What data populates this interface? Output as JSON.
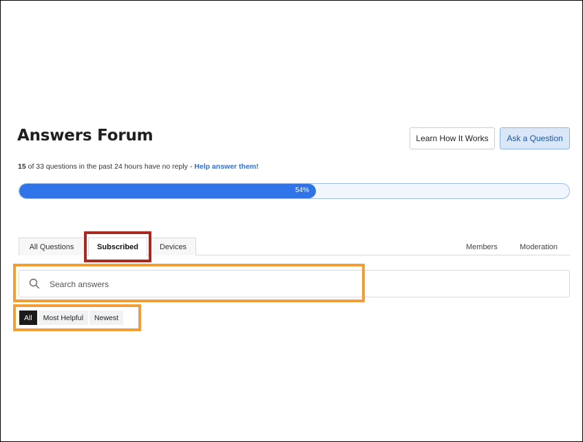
{
  "page": {
    "title": "Answers Forum",
    "learn_button": "Learn How It Works",
    "ask_button": "Ask a Question"
  },
  "stats": {
    "unanswered": "15",
    "text": " of 33 questions in the past 24 hours have no reply - ",
    "link": "Help answer them!"
  },
  "progress": {
    "percent": 54,
    "label": "54%"
  },
  "tabs": [
    {
      "label": "All Questions"
    },
    {
      "label": "Subscribed",
      "active": true
    },
    {
      "label": "Devices"
    }
  ],
  "right_tabs": [
    {
      "label": "Members"
    },
    {
      "label": "Moderation"
    }
  ],
  "search": {
    "placeholder": "Search answers",
    "value": ""
  },
  "filters": [
    {
      "label": "All",
      "active": true
    },
    {
      "label": "Most Helpful"
    },
    {
      "label": "Newest"
    }
  ],
  "colors": {
    "accent": "#2f74e8",
    "highlight_red": "#a8291f",
    "highlight_orange": "#f29d38"
  }
}
